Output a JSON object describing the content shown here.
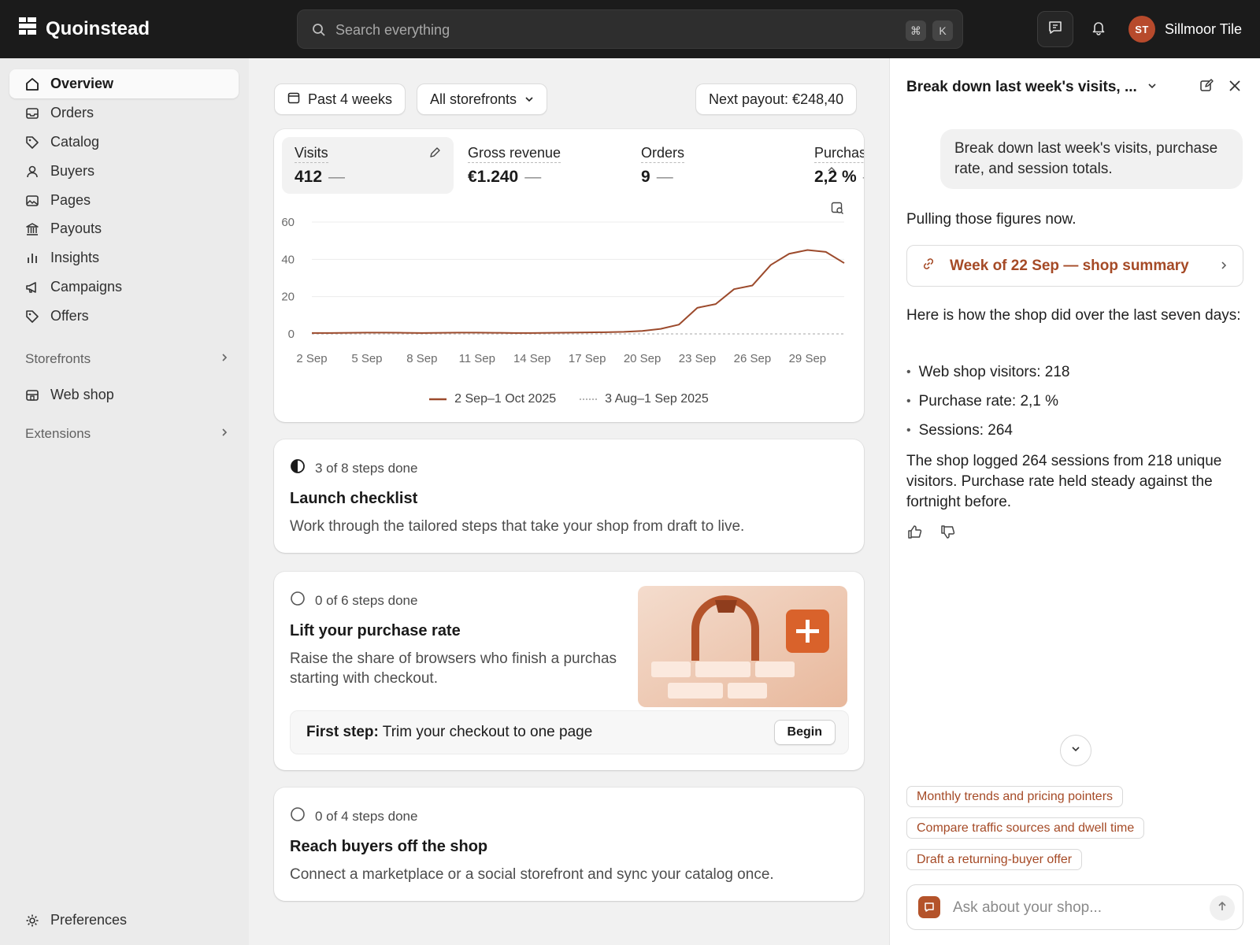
{
  "app": {
    "name": "Quoinstead"
  },
  "search": {
    "placeholder": "Search everything",
    "shortcut_cmd": "⌘",
    "shortcut_key": "K"
  },
  "user": {
    "initials": "ST",
    "name": "Sillmoor Tile"
  },
  "sidebar": {
    "items": [
      {
        "label": "Overview",
        "icon": "home-icon",
        "active": true
      },
      {
        "label": "Orders",
        "icon": "inbox-icon"
      },
      {
        "label": "Catalog",
        "icon": "tag-icon"
      },
      {
        "label": "Buyers",
        "icon": "person-icon"
      },
      {
        "label": "Pages",
        "icon": "image-icon"
      },
      {
        "label": "Payouts",
        "icon": "bank-icon"
      },
      {
        "label": "Insights",
        "icon": "bar-chart-icon"
      },
      {
        "label": "Campaigns",
        "icon": "megaphone-icon"
      },
      {
        "label": "Offers",
        "icon": "discount-tag-icon"
      }
    ],
    "storefronts_label": "Storefronts",
    "web_shop_label": "Web shop",
    "extensions_label": "Extensions",
    "preferences_label": "Preferences"
  },
  "filters": {
    "date_range": "Past 4 weeks",
    "storefront": "All storefronts",
    "payout": "Next payout: €248,40"
  },
  "metrics": [
    {
      "label": "Visits",
      "value": "412",
      "trend": "—"
    },
    {
      "label": "Gross revenue",
      "value": "€1.240",
      "trend": "—"
    },
    {
      "label": "Orders",
      "value": "9",
      "trend": "—"
    },
    {
      "label": "Purchase rate",
      "value": "2,2 %",
      "trend": "—"
    }
  ],
  "chart_data": {
    "type": "line",
    "x": [
      "2 Sep",
      "3 Sep",
      "4 Sep",
      "5 Sep",
      "6 Sep",
      "7 Sep",
      "8 Sep",
      "9 Sep",
      "10 Sep",
      "11 Sep",
      "12 Sep",
      "13 Sep",
      "14 Sep",
      "15 Sep",
      "16 Sep",
      "17 Sep",
      "18 Sep",
      "19 Sep",
      "20 Sep",
      "21 Sep",
      "22 Sep",
      "23 Sep",
      "24 Sep",
      "25 Sep",
      "26 Sep",
      "27 Sep",
      "28 Sep",
      "29 Sep",
      "30 Sep",
      "1 Oct"
    ],
    "x_tick_labels": [
      "2 Sep",
      "5 Sep",
      "8 Sep",
      "11 Sep",
      "14 Sep",
      "17 Sep",
      "20 Sep",
      "23 Sep",
      "26 Sep",
      "29 Sep"
    ],
    "y_ticks": [
      0,
      20,
      40,
      60
    ],
    "ylim": [
      0,
      60
    ],
    "series": [
      {
        "name": "2 Sep–1 Oct 2025",
        "color": "#9c4a2c",
        "style": "solid",
        "values": [
          0.5,
          0.5,
          0.6,
          0.7,
          0.7,
          0.6,
          0.5,
          0.6,
          0.7,
          0.7,
          0.6,
          0.5,
          0.5,
          0.6,
          0.7,
          0.8,
          0.9,
          1.1,
          1.6,
          2.7,
          5,
          14,
          16,
          24,
          26,
          37,
          43,
          45,
          44,
          38
        ]
      },
      {
        "name": "3 Aug–1 Sep 2025",
        "color": "#c4c4c4",
        "style": "dotted",
        "values": [
          0,
          0,
          0,
          0,
          0,
          0,
          0,
          0,
          0,
          0,
          0,
          0,
          0,
          0,
          0,
          0,
          0,
          0,
          0,
          0,
          0,
          0,
          0,
          0,
          0,
          0,
          0,
          0,
          0,
          0
        ]
      }
    ]
  },
  "checklist": {
    "launch": {
      "steps": "3 of 8 steps done",
      "title": "Launch checklist",
      "desc": "Work through the tailored steps that take your shop from draft to live."
    },
    "purchase": {
      "steps": "0 of 6 steps done",
      "title": "Lift your purchase rate",
      "desc_line1": "Raise the share of browsers who finish a purchas",
      "desc_line2": "starting with checkout.",
      "first_step_label": "First step:",
      "first_step_text": "Trim your checkout to one page",
      "begin_label": "Begin"
    },
    "reach": {
      "steps": "0 of 4 steps done",
      "title": "Reach buyers off the shop",
      "desc": "Connect a marketplace or a social storefront and sync your catalog once."
    }
  },
  "panel": {
    "title": "Break down last week's visits, ...",
    "user_message": "Break down last week's visits, purchase rate, and session totals.",
    "status": "Pulling those figures now.",
    "link_card": "Week of 22 Sep — shop summary",
    "intro": "Here is how the shop did over the last seven days:",
    "bullets": [
      "Web shop visitors: 218",
      "Purchase rate: 2,1 %",
      "Sessions: 264"
    ],
    "summary": "The shop logged 264 sessions from 218 unique visitors. Purchase rate held steady against the fortnight before.",
    "suggestions": [
      "Monthly trends and pricing pointers",
      "Compare traffic sources and dwell time",
      "Draft a returning-buyer offer"
    ],
    "compose_placeholder": "Ask about your shop..."
  }
}
